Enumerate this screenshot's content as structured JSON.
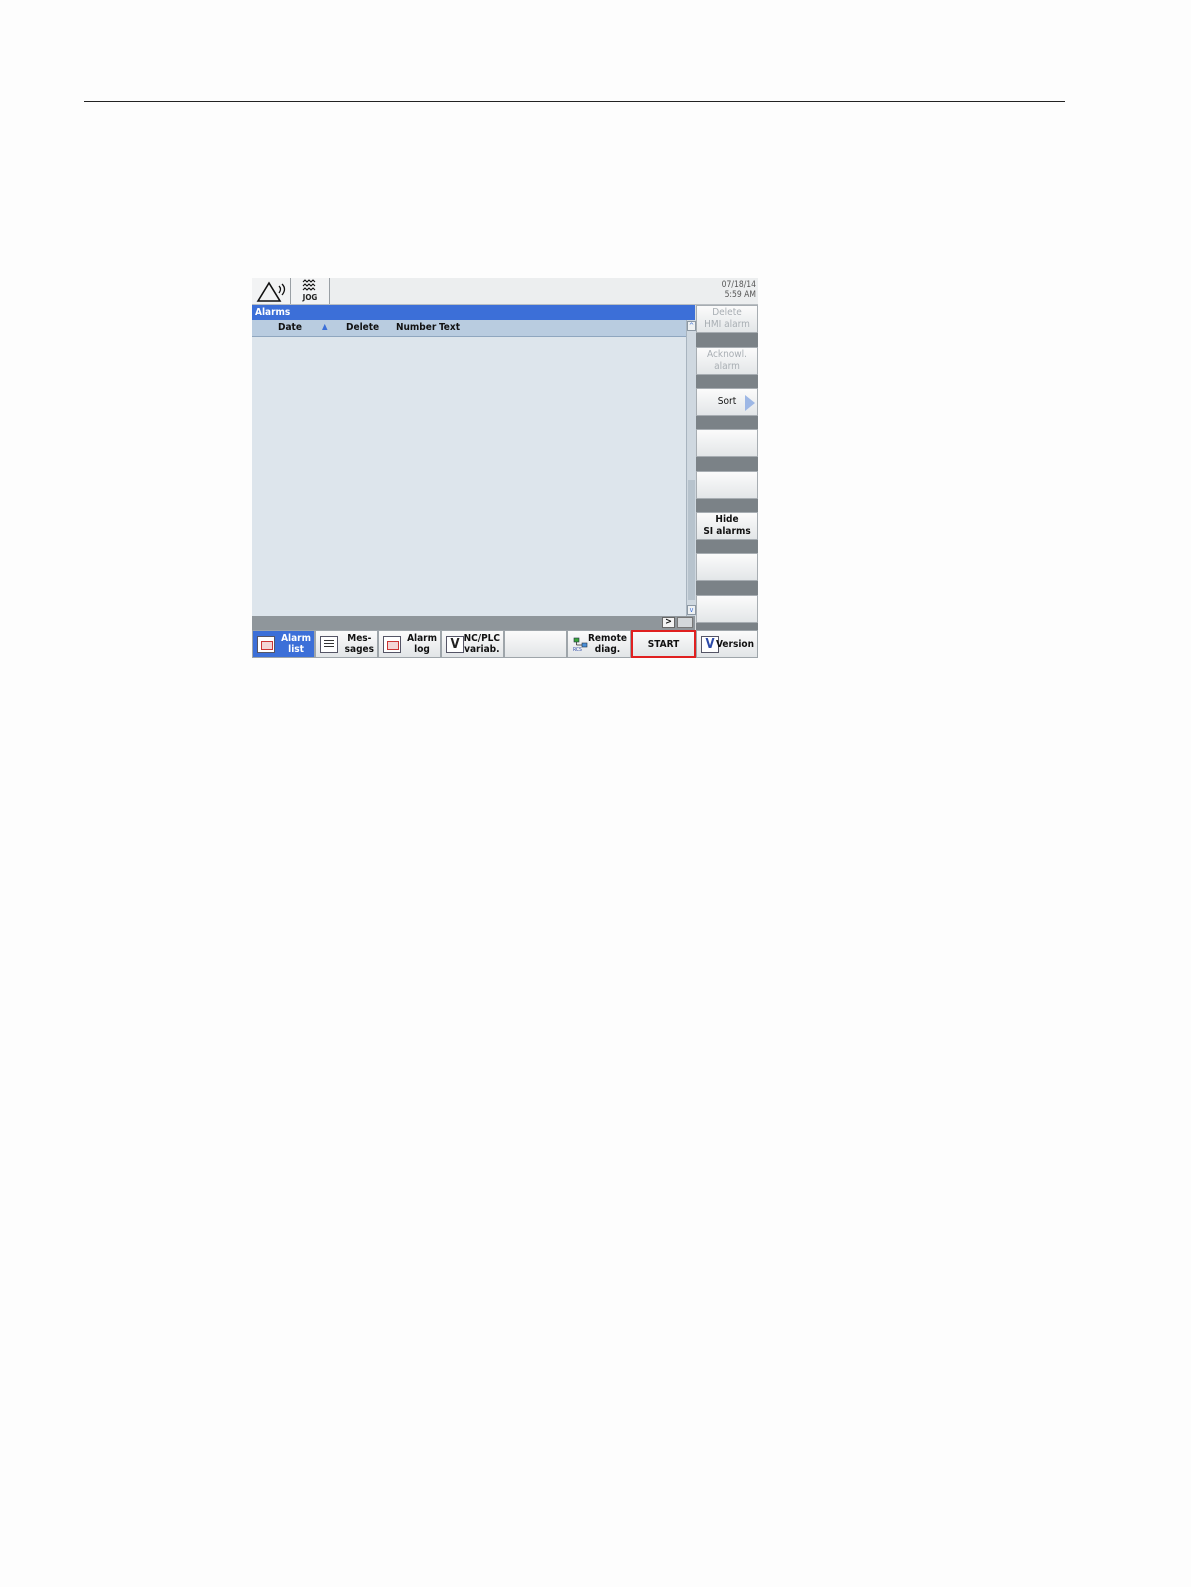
{
  "topbar": {
    "mode": "JOG",
    "date": "07/18/14",
    "time": "5:59 AM"
  },
  "alarms": {
    "title": "Alarms",
    "columns": [
      "Date",
      "Delete",
      "Number",
      "Text"
    ]
  },
  "vertical_softkeys": [
    {
      "label": "Delete\nHMI alarm",
      "enabled": false
    },
    {
      "label": "Acknowl.\nalarm",
      "enabled": false
    },
    {
      "label": "Sort",
      "enabled": true
    },
    {
      "label": "",
      "enabled": true
    },
    {
      "label": "",
      "enabled": true
    },
    {
      "label": "Hide\nSI alarms",
      "enabled": true
    },
    {
      "label": "",
      "enabled": true
    },
    {
      "label": "",
      "enabled": true
    }
  ],
  "horizontal_softkeys": [
    {
      "label": "Alarm\nlist",
      "icon": "alarm-list-icon",
      "active": true
    },
    {
      "label": "Mes-\nsages",
      "icon": "messages-icon",
      "active": false
    },
    {
      "label": "Alarm\nlog",
      "icon": "alarm-log-icon",
      "active": false
    },
    {
      "label": "NC/PLC\nvariab.",
      "icon": "variables-icon",
      "active": false
    },
    {
      "label": "",
      "icon": "",
      "active": false
    },
    {
      "label": "Remote\ndiag.",
      "icon": "remote-diagnosis-icon",
      "icon_text": "RCS",
      "active": false
    },
    {
      "label": "START",
      "icon": "",
      "active": false,
      "highlighted": true
    },
    {
      "label": "Version",
      "icon": "version-icon",
      "icon_text": "V",
      "active": false
    }
  ],
  "colors": {
    "title_bar": "#3c6fd8",
    "list_background": "#dde5ec",
    "highlight_border": "#e02020"
  }
}
